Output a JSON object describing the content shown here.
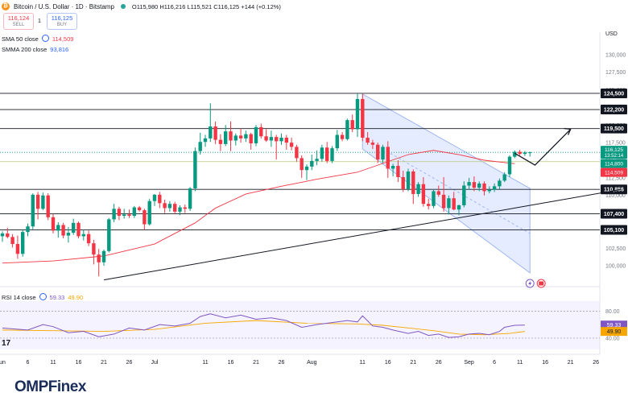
{
  "header": {
    "pair": "Bitcoin / U.S. Dollar · 1D · Bitstamp",
    "ohlc": "O115,980 H116,216 L115,521 C116,125 +144 (+0.12%)",
    "sell_price": "116,124",
    "sell_label": "SELL",
    "buy_price": "116,125",
    "buy_label": "BUY",
    "spread": "1",
    "sma50_label": "SMA 50 close",
    "sma50_value": "114,509",
    "smma200_label": "SMMA 200 close",
    "smma200_value": "93,816",
    "rsi_label": "RSI 14 close",
    "rsi_value": "59.33",
    "rsi_ma_value": "49.90",
    "currency": "USD"
  },
  "brand": {
    "logo_text": "OMPFinex",
    "tv_mark": "17"
  },
  "colors": {
    "up": "#089981",
    "down": "#f23645",
    "sma": "#f23645",
    "rsi": "#7e57c2",
    "rsi_ma": "#f7a600",
    "channel": "#2962ff"
  },
  "chart_data": {
    "type": "candlestick",
    "y_axis": {
      "min": 97500,
      "max": 132500,
      "ticks": [
        100000,
        102500,
        105000,
        107500,
        110000,
        112500,
        115000,
        117500,
        120000,
        122500,
        125000,
        127500,
        130000
      ],
      "tick_labels": [
        "100,000",
        "102,500",
        "105,000",
        "107,500",
        "110,000",
        "112,500",
        "115,000",
        "117,500",
        "120,000",
        "122,500",
        "125,000",
        "127,500",
        "130,000"
      ]
    },
    "x_axis": {
      "labels": [
        "un",
        "6",
        "11",
        "16",
        "21",
        "26",
        "Jul",
        "11",
        "16",
        "21",
        "26",
        "Aug",
        "11",
        "16",
        "21",
        "26",
        "Sep",
        "6",
        "11",
        "16",
        "21",
        "26"
      ],
      "label_day": [
        0,
        5,
        10,
        15,
        20,
        25,
        30,
        40,
        45,
        50,
        55,
        61,
        71,
        76,
        81,
        86,
        92,
        97,
        102,
        107,
        112,
        117
      ]
    },
    "levels": [
      {
        "value": 124500,
        "label": "124,500"
      },
      {
        "value": 122200,
        "label": "122,200"
      },
      {
        "value": 119500,
        "label": "119,500"
      },
      {
        "value": 110856,
        "label": "110,856"
      },
      {
        "value": 107400,
        "label": "107,400"
      },
      {
        "value": 105100,
        "label": "105,100"
      }
    ],
    "price_labels": [
      {
        "value": 116125,
        "label": "116,125",
        "sub": "13:52:14",
        "color": "#089981"
      },
      {
        "value": 114800,
        "label": "114,800",
        "color": "#089981"
      },
      {
        "value": 114509,
        "label": "114,509",
        "color": "#f23645"
      }
    ],
    "candles": [
      [
        104200,
        104900,
        103400,
        104600
      ],
      [
        104600,
        105400,
        103900,
        104100
      ],
      [
        104100,
        104500,
        102600,
        103100
      ],
      [
        103100,
        104300,
        101000,
        101700
      ],
      [
        101700,
        105200,
        101300,
        104800
      ],
      [
        104800,
        106000,
        104200,
        105600
      ],
      [
        105600,
        110300,
        105200,
        110100
      ],
      [
        110100,
        110500,
        106600,
        108100
      ],
      [
        108100,
        110400,
        107900,
        110000
      ],
      [
        110000,
        110300,
        106500,
        106900
      ],
      [
        106900,
        107400,
        104600,
        105000
      ],
      [
        105000,
        106200,
        104000,
        105800
      ],
      [
        105800,
        106100,
        103900,
        104300
      ],
      [
        104300,
        105500,
        103300,
        104700
      ],
      [
        104700,
        106700,
        104400,
        106100
      ],
      [
        106100,
        106300,
        103900,
        104200
      ],
      [
        104200,
        105100,
        103600,
        104500
      ],
      [
        104500,
        105000,
        102800,
        103200
      ],
      [
        103200,
        103700,
        100200,
        101600
      ],
      [
        101600,
        102400,
        98500,
        100500
      ],
      [
        100500,
        102300,
        100000,
        102100
      ],
      [
        102100,
        106800,
        101900,
        106600
      ],
      [
        106600,
        108800,
        106200,
        108100
      ],
      [
        108100,
        108400,
        106500,
        107100
      ],
      [
        107100,
        108100,
        106700,
        107300
      ],
      [
        107300,
        108000,
        106800,
        107100
      ],
      [
        107100,
        108500,
        106800,
        108300
      ],
      [
        108300,
        108500,
        107700,
        107900
      ],
      [
        107900,
        108100,
        105100,
        105900
      ],
      [
        105900,
        109500,
        105700,
        109200
      ],
      [
        109200,
        110200,
        108500,
        110100
      ],
      [
        110100,
        110500,
        108200,
        108900
      ],
      [
        108900,
        109400,
        107500,
        108200
      ],
      [
        108200,
        109200,
        107700,
        108800
      ],
      [
        108800,
        109100,
        107400,
        107700
      ],
      [
        107700,
        108600,
        107200,
        108300
      ],
      [
        108300,
        108700,
        107500,
        108100
      ],
      [
        108100,
        111200,
        107800,
        111000
      ],
      [
        111000,
        116800,
        110600,
        116300
      ],
      [
        116300,
        118900,
        115800,
        117600
      ],
      [
        117600,
        118600,
        116900,
        118100
      ],
      [
        118100,
        123100,
        117600,
        119800
      ],
      [
        119800,
        120500,
        117300,
        117900
      ],
      [
        117900,
        118700,
        116300,
        117300
      ],
      [
        117300,
        120000,
        117000,
        119100
      ],
      [
        119100,
        120500,
        116300,
        117800
      ],
      [
        117800,
        118800,
        117100,
        118500
      ],
      [
        118500,
        119500,
        117500,
        118100
      ],
      [
        118100,
        119200,
        117600,
        118700
      ],
      [
        118700,
        118900,
        116500,
        117400
      ],
      [
        117400,
        120000,
        117000,
        119700
      ],
      [
        119700,
        120200,
        118100,
        118400
      ],
      [
        118400,
        119400,
        117600,
        117800
      ],
      [
        117800,
        119200,
        116900,
        118300
      ],
      [
        118300,
        118600,
        115100,
        117700
      ],
      [
        117700,
        118800,
        117200,
        118200
      ],
      [
        118200,
        118600,
        116500,
        117500
      ],
      [
        117500,
        118200,
        116400,
        116900
      ],
      [
        116900,
        117200,
        114800,
        115300
      ],
      [
        115300,
        115700,
        112500,
        113600
      ],
      [
        113600,
        114400,
        112200,
        114100
      ],
      [
        114100,
        115800,
        113600,
        114900
      ],
      [
        114900,
        116400,
        114300,
        115200
      ],
      [
        115200,
        117200,
        114800,
        116800
      ],
      [
        116800,
        117600,
        114600,
        114900
      ],
      [
        114900,
        117000,
        114600,
        116700
      ],
      [
        116700,
        119300,
        116300,
        118600
      ],
      [
        118600,
        119000,
        117700,
        118000
      ],
      [
        118000,
        120900,
        117800,
        120700
      ],
      [
        120700,
        121500,
        119000,
        119400
      ],
      [
        119400,
        124500,
        118300,
        123700
      ],
      [
        123700,
        124400,
        117700,
        118200
      ],
      [
        118200,
        119000,
        117200,
        117500
      ],
      [
        117500,
        117900,
        116600,
        117200
      ],
      [
        117200,
        117500,
        114600,
        115100
      ],
      [
        115100,
        117200,
        114600,
        116900
      ],
      [
        116900,
        117700,
        112500,
        113800
      ],
      [
        113800,
        114500,
        112700,
        114200
      ],
      [
        114200,
        115000,
        111900,
        112600
      ],
      [
        112600,
        113500,
        110500,
        110900
      ],
      [
        110900,
        113800,
        110600,
        113400
      ],
      [
        113400,
        113700,
        108800,
        110200
      ],
      [
        110200,
        111900,
        109800,
        111600
      ],
      [
        111600,
        112600,
        108400,
        108800
      ],
      [
        108800,
        109500,
        108000,
        108500
      ],
      [
        108500,
        110900,
        108200,
        110600
      ],
      [
        110600,
        111400,
        109800,
        110100
      ],
      [
        110100,
        112600,
        107700,
        108200
      ],
      [
        108200,
        110000,
        107300,
        109600
      ],
      [
        109600,
        110500,
        107900,
        108000
      ],
      [
        108000,
        108700,
        107200,
        108600
      ],
      [
        108600,
        112000,
        108300,
        111400
      ],
      [
        111400,
        112500,
        110800,
        111900
      ],
      [
        111900,
        112700,
        110600,
        111100
      ],
      [
        111100,
        112000,
        110600,
        111700
      ],
      [
        111700,
        112000,
        110000,
        110600
      ],
      [
        110600,
        111300,
        110300,
        110800
      ],
      [
        110800,
        111700,
        110500,
        111300
      ],
      [
        111300,
        112400,
        110800,
        112100
      ],
      [
        112100,
        113300,
        111900,
        113000
      ],
      [
        113000,
        115700,
        112600,
        115500
      ],
      [
        115500,
        116400,
        115300,
        116200
      ],
      [
        116200,
        116500,
        115700,
        115900
      ],
      [
        115900,
        116300,
        115600,
        116100
      ],
      [
        116100,
        116216,
        115521,
        116125
      ]
    ],
    "sma50": [
      [
        0,
        100400
      ],
      [
        10,
        100700
      ],
      [
        20,
        101400
      ],
      [
        30,
        103100
      ],
      [
        38,
        106100
      ],
      [
        42,
        108200
      ],
      [
        48,
        110200
      ],
      [
        55,
        111300
      ],
      [
        62,
        112300
      ],
      [
        70,
        113300
      ],
      [
        76,
        114800
      ],
      [
        80,
        115800
      ],
      [
        85,
        116400
      ],
      [
        90,
        115800
      ],
      [
        95,
        115000
      ],
      [
        101,
        114509
      ]
    ],
    "trendline": [
      [
        20,
        98000
      ],
      [
        122,
        110856
      ]
    ],
    "channel": {
      "upper": [
        [
          71,
          124400
        ],
        [
          104,
          111000
        ]
      ],
      "lower": [
        [
          71,
          116600
        ],
        [
          104,
          99000
        ]
      ],
      "mid": [
        [
          74,
          117000
        ],
        [
          104,
          104600
        ]
      ]
    },
    "projection": [
      [
        101,
        116000
      ],
      [
        105,
        114300
      ],
      [
        112,
        119400
      ]
    ],
    "rsi": {
      "range": [
        28,
        90
      ],
      "ticks": [
        80,
        40
      ],
      "labels": [
        "80.00",
        "40.00"
      ],
      "values": [
        [
          0,
          55
        ],
        [
          5,
          52
        ],
        [
          8,
          60
        ],
        [
          10,
          57
        ],
        [
          13,
          48
        ],
        [
          16,
          50
        ],
        [
          19,
          42
        ],
        [
          22,
          46
        ],
        [
          25,
          55
        ],
        [
          28,
          52
        ],
        [
          31,
          60
        ],
        [
          34,
          58
        ],
        [
          37,
          62
        ],
        [
          39,
          72
        ],
        [
          41,
          76
        ],
        [
          44,
          70
        ],
        [
          47,
          74
        ],
        [
          50,
          68
        ],
        [
          53,
          70
        ],
        [
          56,
          66
        ],
        [
          59,
          56
        ],
        [
          62,
          60
        ],
        [
          65,
          63
        ],
        [
          68,
          66
        ],
        [
          70,
          64
        ],
        [
          71,
          73
        ],
        [
          73,
          58
        ],
        [
          75,
          56
        ],
        [
          77,
          52
        ],
        [
          80,
          47
        ],
        [
          82,
          50
        ],
        [
          84,
          44
        ],
        [
          86,
          46
        ],
        [
          88,
          41
        ],
        [
          90,
          42
        ],
        [
          92,
          46
        ],
        [
          94,
          47
        ],
        [
          96,
          45
        ],
        [
          98,
          50
        ],
        [
          99,
          56
        ],
        [
          101,
          59
        ],
        [
          103,
          59.33
        ]
      ],
      "ma": [
        [
          0,
          52
        ],
        [
          10,
          51
        ],
        [
          20,
          50
        ],
        [
          30,
          53
        ],
        [
          40,
          62
        ],
        [
          50,
          66
        ],
        [
          60,
          62
        ],
        [
          70,
          61
        ],
        [
          75,
          59
        ],
        [
          80,
          55
        ],
        [
          85,
          51
        ],
        [
          90,
          46
        ],
        [
          95,
          45
        ],
        [
          100,
          47
        ],
        [
          103,
          49.9
        ]
      ]
    },
    "markers": [
      "lightning-icon",
      "flag-icon"
    ]
  }
}
